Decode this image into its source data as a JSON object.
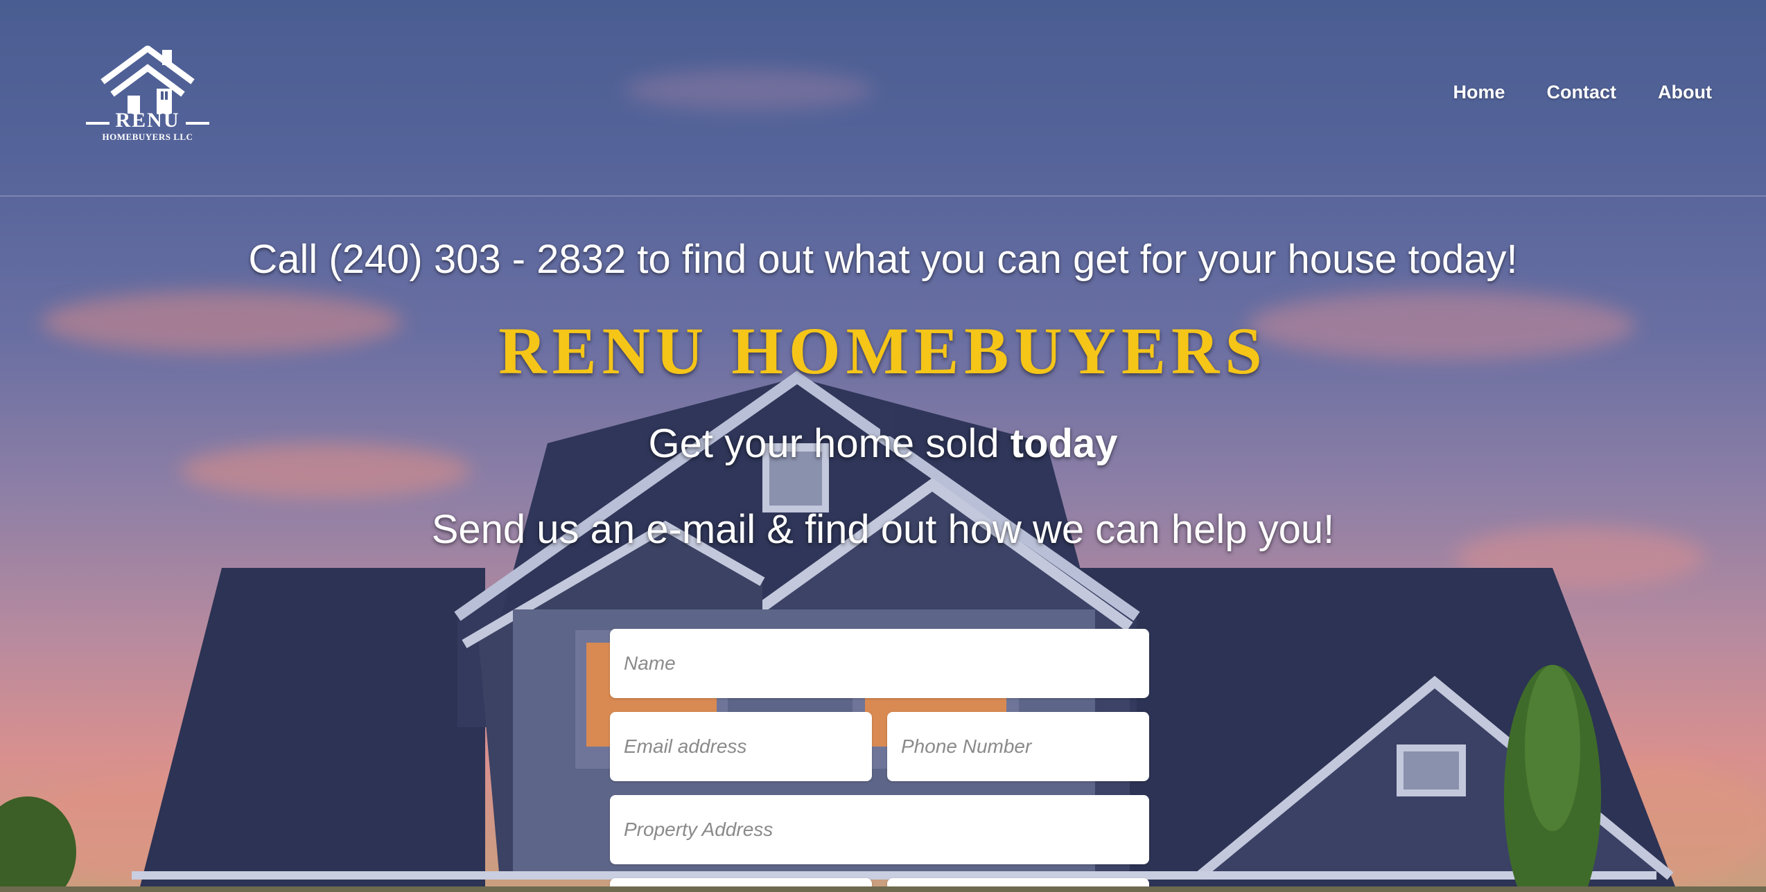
{
  "header": {
    "logo": {
      "wordmark": "RENU",
      "subtext": "HOMEBUYERS LLC",
      "icon": "house-icon"
    },
    "nav": [
      {
        "label": "Home"
      },
      {
        "label": "Contact"
      },
      {
        "label": "About"
      }
    ]
  },
  "hero": {
    "headline": "Call (240) 303 - 2832 to find out what you can get for your house today!",
    "brand": "RENU HOMEBUYERS",
    "tagline_prefix": "Get your home sold ",
    "tagline_emphasis": "today",
    "subline": "Send us an e-mail & find out how we can help you!"
  },
  "form": {
    "name_placeholder": "Name",
    "email_placeholder": "Email address",
    "phone_placeholder": "Phone Number",
    "address_placeholder": "Property Address"
  },
  "colors": {
    "brand_gold": "#f5c518",
    "text_white": "#ffffff",
    "sky_top": "#4a5d92",
    "sky_bottom": "#d9908e",
    "roof": "#2c3354"
  }
}
